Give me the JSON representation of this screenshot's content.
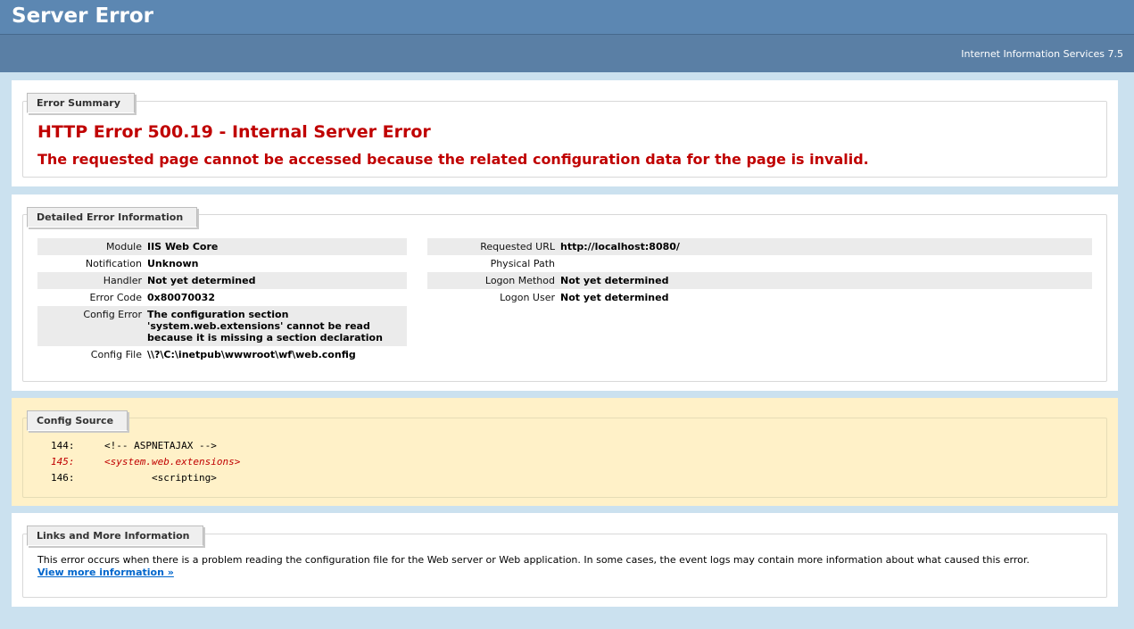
{
  "header": {
    "title": "Server Error",
    "subtitle": "Internet Information Services 7.5"
  },
  "summary": {
    "tab": "Error Summary",
    "error_title": "HTTP Error 500.19 - Internal Server Error",
    "error_desc": "The requested page cannot be accessed because the related configuration data for the page is invalid."
  },
  "details": {
    "tab": "Detailed Error Information",
    "left": [
      {
        "label": "Module",
        "value": "IIS Web Core"
      },
      {
        "label": "Notification",
        "value": "Unknown"
      },
      {
        "label": "Handler",
        "value": "Not yet determined"
      },
      {
        "label": "Error Code",
        "value": "0x80070032"
      },
      {
        "label": "Config Error",
        "value": "The configuration section 'system.web.extensions' cannot be read because it is missing a section declaration"
      },
      {
        "label": "Config File",
        "value": "\\\\?\\C:\\inetpub\\wwwroot\\wf\\web.config"
      }
    ],
    "right": [
      {
        "label": "Requested URL",
        "value": "http://localhost:8080/"
      },
      {
        "label": "Physical Path",
        "value": ""
      },
      {
        "label": "Logon Method",
        "value": "Not yet determined"
      },
      {
        "label": "Logon User",
        "value": "Not yet determined"
      }
    ]
  },
  "config_source": {
    "tab": "Config Source",
    "lines": [
      {
        "num": "144:",
        "text": "<!-- ASPNETAJAX -->"
      },
      {
        "num": "145:",
        "text": "<system.web.extensions>"
      },
      {
        "num": "146:",
        "text": "        <scripting>"
      }
    ]
  },
  "links": {
    "tab": "Links and More Information",
    "text": "This error occurs when there is a problem reading the configuration file for the Web server or Web application. In some cases, the event logs may contain more information about what caused this error.",
    "link": "View more information »"
  }
}
